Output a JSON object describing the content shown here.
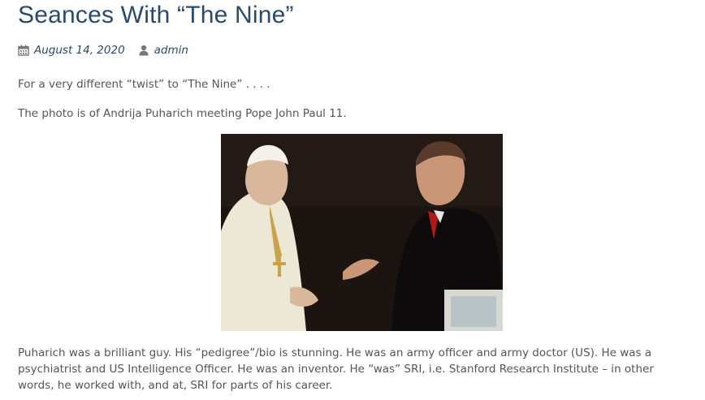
{
  "post": {
    "title": "Seances With “The Nine”",
    "date": "August 14, 2020",
    "author": "admin",
    "paragraphs": [
      "For a very different “twist” to “The Nine” . . . .",
      "The photo is of Andrija Puharich meeting Pope John Paul 11.",
      "Puharich was a brilliant guy. His “pedigree”/bio is stunning. He was an army officer and army doctor (US). He was a psychiatrist and US Intelligence Officer. He was an inventor. He “was” SRI, i.e. Stanford Research Institute – in other words, he worked with, and at, SRI for parts of his career."
    ]
  },
  "icons": {
    "date": "calendar-icon",
    "author": "user-icon"
  },
  "colors": {
    "title": "#2b4a6b",
    "meta": "#2b4a6b",
    "body_text": "#555555",
    "icon": "#777777"
  }
}
